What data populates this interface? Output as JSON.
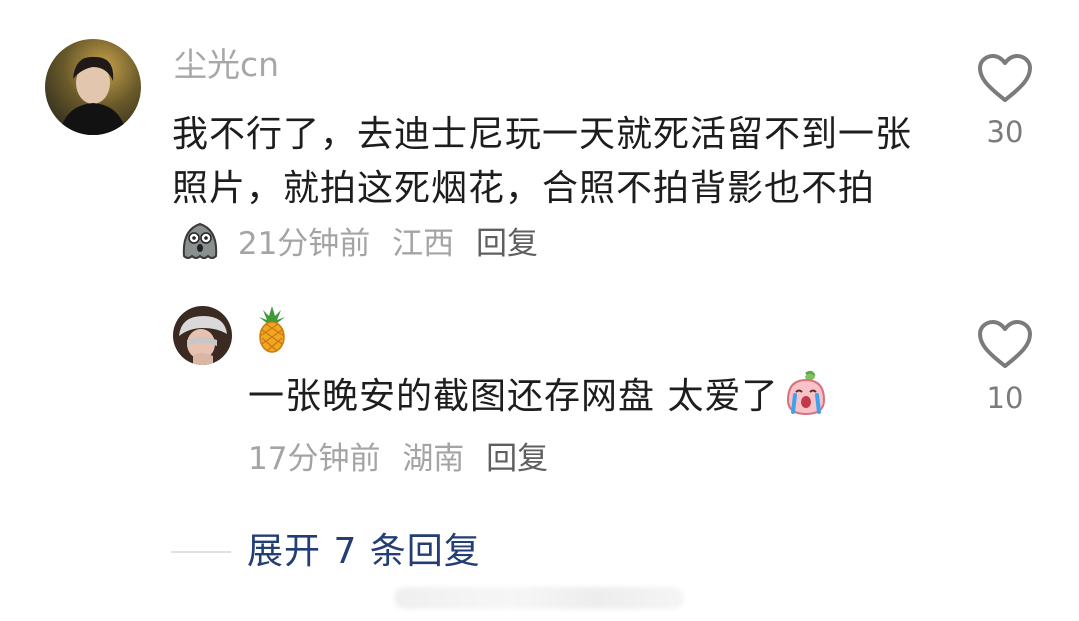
{
  "comment": {
    "username": "尘光cn",
    "text": "我不行了，去迪士尼玩一天就死活留不到一张照片，就拍这死烟花，合照不拍背影也不拍",
    "time": "21分钟前",
    "location": "江西",
    "reply_label": "回复",
    "like_count": "30",
    "inline_emoji": "ghost-shocked-emoji"
  },
  "reply": {
    "username_emoji": "pineapple-emoji",
    "text": "一张晚安的截图还存网盘 太爱了",
    "time": "17分钟前",
    "location": "湖南",
    "reply_label": "回复",
    "like_count": "10",
    "inline_emoji": "crying-peach-emoji"
  },
  "expand": {
    "label": "展开 7 条回复"
  },
  "colors": {
    "username": "#a7a7a7",
    "body_text": "#1d1d1d",
    "meta_text": "#a4a4a4",
    "link_blue": "#223e74",
    "icon_gray": "#7b7b7b"
  }
}
